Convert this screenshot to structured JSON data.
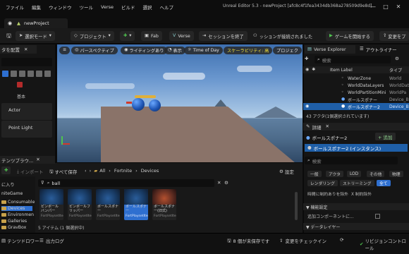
{
  "menu": [
    "ファイル",
    "編集",
    "ウィンドウ",
    "ツール",
    "Verse",
    "ビルド",
    "選択",
    "ヘルプ"
  ],
  "window_title": "Unreal Editor 5.3 - newProject [afc8c4f1fea3434db368a278509d9e8d]",
  "project_tab": "newProject",
  "toolbar": {
    "select_mode": "選択モード",
    "project": "プロジェクト",
    "fab": "Fab",
    "verse": "Verse",
    "end_session": "セッションを終了",
    "connected": "ッションが接続されました",
    "start_game": "ゲームを開始する",
    "changes": "変更をプ"
  },
  "left_panel": {
    "tab": "タを配置",
    "section": "基本",
    "items": [
      "Actor",
      "Point Light"
    ]
  },
  "viewport": {
    "perspective": "パースペクティブ",
    "lighting": "ライティングあり",
    "show": "表示",
    "time_of_day": "Time of Day",
    "scalability": "スケーラビリティ: 高",
    "project": "プロジェク"
  },
  "outliner": {
    "tabs": [
      "Verse Explorer",
      "アウトライナー"
    ],
    "search_placeholder": "検索",
    "col_label": "Item Label",
    "col_type": "タイプ",
    "rows": [
      {
        "name": "WaterZone",
        "type": "World"
      },
      {
        "name": "WorldDataLayers",
        "type": "WorldDat"
      },
      {
        "name": "WorldPartitionMini",
        "type": "WorldPa"
      },
      {
        "name": "ボールスポナー",
        "type": "Device_B"
      },
      {
        "name": "ボールスポナー2",
        "type": "Device_B"
      }
    ],
    "count": "43 アクタ(1個選択されています)"
  },
  "details": {
    "tab": "詳細",
    "object": "ボールスポナー2",
    "add": "+ 追加",
    "instance": "ボールスポナー2 (インスタンス)",
    "search_placeholder": "検索",
    "filters_row1": [
      "一般",
      "アクタ",
      "LOD",
      "その他",
      "物理"
    ],
    "filters_row2": [
      "レンダリング",
      "ストリーミング",
      "全て"
    ],
    "checks": [
      "時間に制約ありを除外",
      "X 制約除外"
    ],
    "section_basic": "▼ 機能設定",
    "add_component": "追加コンポーネントに...",
    "section_datalayers": "▼ データレイヤー"
  },
  "content_browser": {
    "tab": "テンツブラウ...",
    "import": "インポート",
    "save_all": "すべて保存",
    "path": [
      "All",
      "Fortnite",
      "Devices"
    ],
    "settings": "設定",
    "favorites": "に入り",
    "folders": [
      "niteGame",
      "Consumable",
      "Devices",
      "Environmen",
      "Galleries",
      "GravBox"
    ],
    "search": "ball",
    "assets": [
      {
        "label": "ピンボールバンパー",
        "sub": "FortPlaysetItem"
      },
      {
        "label": "ピンボールフリッパー",
        "sub": "FortPlaysetItem"
      },
      {
        "label": "ボールスポナー",
        "sub": "FortPlaysetItem"
      },
      {
        "label": "ボールスポナー",
        "sub": "FortPlaysetItem"
      },
      {
        "label": "ボールスポナー(旧式)",
        "sub": "FortPlaysetItem"
      }
    ],
    "count": "5 アイテム (1 個選択中)"
  },
  "statusbar": {
    "drawer": "テンツドロワー",
    "output": "出力ログ",
    "unsaved": "8 個が未保存です",
    "check_changes": "変更をチェックイン",
    "revision": "リビジョンコントロール"
  },
  "colors": {
    "accent": "#2e6fd0",
    "play": "#4fc34f",
    "ball": "#1e55b4"
  }
}
